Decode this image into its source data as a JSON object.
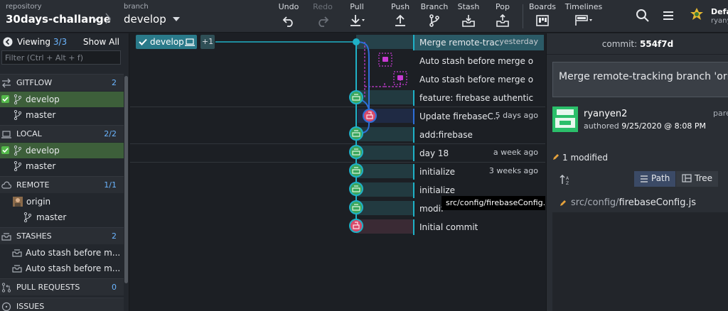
{
  "toolbar": {
    "repo_label": "repository",
    "repo_name": "30days-challange",
    "branch_label": "branch",
    "branch_name": "develop",
    "buttons": [
      {
        "label": "Undo",
        "icon": "undo-icon",
        "enabled": true
      },
      {
        "label": "Redo",
        "icon": "redo-icon",
        "enabled": false
      },
      {
        "label": "Pull",
        "icon": "pull-icon",
        "enabled": true
      },
      {
        "label": "Push",
        "icon": "push-icon",
        "enabled": true
      },
      {
        "label": "Branch",
        "icon": "branch-icon",
        "enabled": true
      },
      {
        "label": "Stash",
        "icon": "stash-icon",
        "enabled": true
      },
      {
        "label": "Pop",
        "icon": "pop-icon",
        "enabled": true
      },
      {
        "label": "Boards",
        "icon": "boards-icon",
        "enabled": true
      },
      {
        "label": "Timelines",
        "icon": "timelines-icon",
        "enabled": true
      }
    ],
    "profile_name": "Defa",
    "profile_user": "ryany"
  },
  "sidebar": {
    "viewing_label": "Viewing",
    "viewing_count": "3/3",
    "show_all": "Show All",
    "filter_placeholder": "Filter (Ctrl + Alt + f)",
    "gitflow": {
      "title": "GITFLOW",
      "count": "2",
      "items": [
        "develop",
        "master"
      ]
    },
    "local": {
      "title": "LOCAL",
      "count": "2/2",
      "items": [
        "develop",
        "master"
      ]
    },
    "remote": {
      "title": "REMOTE",
      "count": "1/1",
      "remote_name": "origin",
      "items": [
        "master"
      ]
    },
    "stashes": {
      "title": "STASHES",
      "count": "2",
      "items": [
        "Auto stash before m...",
        "Auto stash before m..."
      ]
    },
    "pull_requests": {
      "title": "PULL REQUESTS",
      "count": "0"
    },
    "issues": {
      "title": "ISSUES"
    }
  },
  "graph": {
    "branch_tag": "develop",
    "extra_refs": "+1",
    "commits": [
      {
        "message": "Merge remote-trac...",
        "date": "yesterday"
      },
      {
        "message": "Auto stash before merge of \"...",
        "date": ""
      },
      {
        "message": "Auto stash before merge of \"...",
        "date": ""
      },
      {
        "message": "feature: firebase authenticati...",
        "date": ""
      },
      {
        "message": "Update firebaseC...",
        "date": "5 days ago"
      },
      {
        "message": "add:firebase",
        "date": ""
      },
      {
        "message": "day 18",
        "date": "a week ago"
      },
      {
        "message": "initialize",
        "date": "3 weeks ago"
      },
      {
        "message": "initialize",
        "date": ""
      },
      {
        "message": "modif",
        "date": ""
      },
      {
        "message": "Initial commit",
        "date": ""
      }
    ],
    "tooltip": "src/config/firebaseConfig.js"
  },
  "detail": {
    "commit_label": "commit:",
    "commit_sha": "554f7d",
    "message": "Merge remote-tracking branch 'origin",
    "author": "ryanyen2",
    "authored_label": "authored",
    "authored_date": "9/25/2020 @ 8:08 PM",
    "parent_label": "pare",
    "modified": "1 modified",
    "path_button": "Path",
    "tree_button": "Tree",
    "file_dir": "src/config/",
    "file_name": "firebaseConfig.js"
  },
  "colors": {
    "main_lane": "#1fb1c7",
    "blue_lane": "#2d6fd9",
    "stash_lane": "#c83bd4",
    "node_green": "#3ba55c",
    "node_red": "#d84a6a",
    "selected_row": "#2b5a66",
    "active_branch": "#3d5f3a"
  }
}
